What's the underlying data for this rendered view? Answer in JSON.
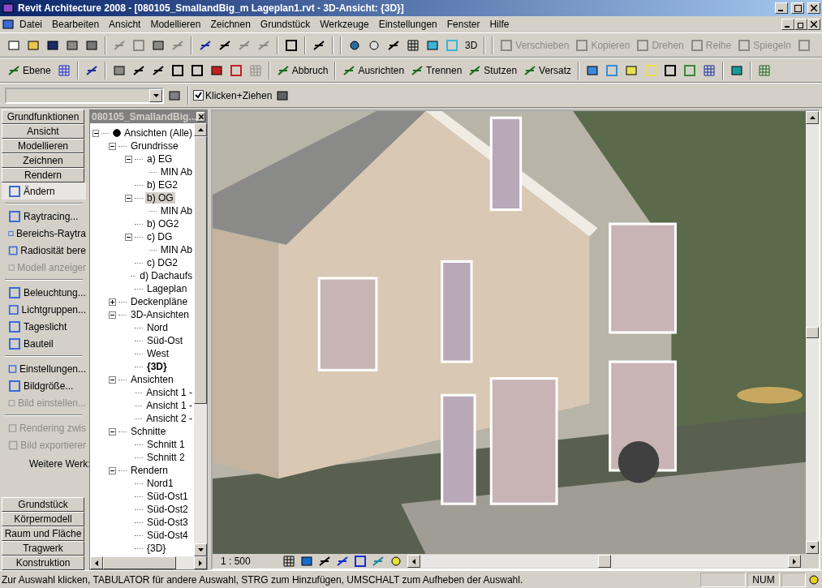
{
  "window": {
    "title": "Revit Architecture 2008 - [080105_SmallandBig_m Lageplan1.rvt - 3D-Ansicht: {3D}]"
  },
  "menu": [
    "Datei",
    "Bearbeiten",
    "Ansicht",
    "Modellieren",
    "Zeichnen",
    "Grundstück",
    "Werkzeuge",
    "Einstellungen",
    "Fenster",
    "Hilfe"
  ],
  "toolbar_1": [
    {
      "label": "3D",
      "disabled": false
    },
    {
      "label": "Verschieben",
      "disabled": true
    },
    {
      "label": "Kopieren",
      "disabled": true
    },
    {
      "label": "Drehen",
      "disabled": true
    },
    {
      "label": "Reihe",
      "disabled": true
    },
    {
      "label": "Spiegeln",
      "disabled": true
    }
  ],
  "toolbar_2": [
    {
      "label": "Ebene"
    },
    {
      "label": "Abbruch"
    },
    {
      "label": "Ausrichten"
    },
    {
      "label": "Trennen"
    },
    {
      "label": "Stutzen"
    },
    {
      "label": "Versatz"
    }
  ],
  "options_bar": {
    "click_drag": {
      "label": "Klicken+Ziehen",
      "checked": true
    }
  },
  "design_bar": {
    "top_tabs": [
      "Grundfunktionen",
      "Ansicht",
      "Modellieren",
      "Zeichnen",
      "Rendern"
    ],
    "groups": [
      [
        {
          "label": "Ändern",
          "selected": true,
          "disabled": false
        }
      ],
      [
        {
          "label": "Raytracing...",
          "selected": false,
          "disabled": false
        },
        {
          "label": "Bereichs-Raytra",
          "selected": false,
          "disabled": false
        },
        {
          "label": "Radiosität bere",
          "selected": false,
          "disabled": false
        },
        {
          "label": "Modell anzeiger",
          "selected": false,
          "disabled": true
        }
      ],
      [
        {
          "label": "Beleuchtung...",
          "selected": false,
          "disabled": false
        },
        {
          "label": "Lichtgruppen...",
          "selected": false,
          "disabled": false
        },
        {
          "label": "Tageslicht",
          "selected": false,
          "disabled": false
        },
        {
          "label": "Bauteil",
          "selected": false,
          "disabled": false
        }
      ],
      [
        {
          "label": "Einstellungen...",
          "selected": false,
          "disabled": false
        },
        {
          "label": "Bildgröße...",
          "selected": false,
          "disabled": false
        },
        {
          "label": "Bild einstellen...",
          "selected": false,
          "disabled": true
        }
      ],
      [
        {
          "label": "Rendering zwis",
          "selected": false,
          "disabled": true
        },
        {
          "label": "Bild exportierer",
          "selected": false,
          "disabled": true
        }
      ]
    ],
    "more": "Weitere Werk:",
    "bottom_tabs": [
      "Grundstück",
      "Körpermodell",
      "Raum und Fläche",
      "Tragwerk",
      "Konstruktion"
    ]
  },
  "project_browser": {
    "title": "080105_SmallandBig...",
    "tree": [
      {
        "label": "Ansichten (Alle)",
        "expanded": true,
        "selected": false,
        "children": [
          {
            "label": "Grundrisse",
            "expanded": true,
            "selected": false,
            "children": [
              {
                "label": "a) EG",
                "expanded": true,
                "selected": false,
                "children": [
                  {
                    "label": "MIN Ab",
                    "selected": false
                  }
                ]
              },
              {
                "label": "b) EG2",
                "selected": false
              },
              {
                "label": "b) OG",
                "expanded": true,
                "selected": true,
                "children": [
                  {
                    "label": "MIN Ab",
                    "selected": false
                  }
                ]
              },
              {
                "label": "b) OG2",
                "selected": false
              },
              {
                "label": "c) DG",
                "expanded": true,
                "selected": false,
                "children": [
                  {
                    "label": "MIN Ab",
                    "selected": false
                  }
                ]
              },
              {
                "label": "c) DG2",
                "selected": false
              },
              {
                "label": "d) Dachaufs",
                "selected": false
              },
              {
                "label": "Lageplan",
                "selected": false
              }
            ]
          },
          {
            "label": "Deckenpläne",
            "expanded": false,
            "selected": false
          },
          {
            "label": "3D-Ansichten",
            "expanded": true,
            "selected": false,
            "children": [
              {
                "label": "Nord",
                "selected": false
              },
              {
                "label": "Süd-Ost",
                "selected": false
              },
              {
                "label": "West",
                "selected": false
              },
              {
                "label": "{3D}",
                "selected": false,
                "open_view": true
              }
            ]
          },
          {
            "label": "Ansichten",
            "expanded": true,
            "selected": false,
            "children": [
              {
                "label": "Ansicht 1 -",
                "selected": false
              },
              {
                "label": "Ansicht 1 -",
                "selected": false
              },
              {
                "label": "Ansicht 2 -",
                "selected": false
              }
            ]
          },
          {
            "label": "Schnitte",
            "expanded": true,
            "selected": false,
            "children": [
              {
                "label": "Schnitt 1",
                "selected": false
              },
              {
                "label": "Schnitt 2",
                "selected": false
              }
            ]
          },
          {
            "label": "Rendern",
            "expanded": true,
            "selected": false,
            "children": [
              {
                "label": "Nord1",
                "selected": false
              },
              {
                "label": "Süd-Ost1",
                "selected": false
              },
              {
                "label": "Süd-Ost2",
                "selected": false
              },
              {
                "label": "Süd-Ost3",
                "selected": false
              },
              {
                "label": "Süd-Ost4",
                "selected": false
              },
              {
                "label": "{3D}",
                "selected": false
              }
            ]
          }
        ]
      }
    ]
  },
  "view": {
    "scale": "1 : 500"
  },
  "status_bar": {
    "message": "Zur Auswahl klicken, TABULATOR für andere Auswahl, STRG zum Hinzufügen, UMSCHALT zum Aufheben der Auswahl.",
    "num": "NUM"
  }
}
